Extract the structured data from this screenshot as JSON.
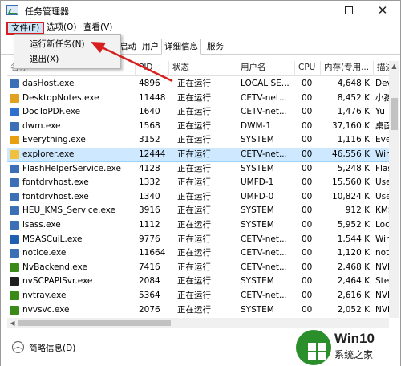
{
  "window": {
    "title": "任务管理器",
    "minimize_glyph": "—",
    "close_glyph": "✕"
  },
  "menu": {
    "file": "文件(F)",
    "options": "选项(O)",
    "view": "查看(V)"
  },
  "file_menu": {
    "run_new_task": "运行新任务(N)",
    "exit": "退出(X)"
  },
  "tabs": {
    "startup": "启动",
    "users": "用户",
    "details": "详细信息",
    "services": "服务"
  },
  "table": {
    "headers": {
      "name": "名称",
      "pid": "PID",
      "status": "状态",
      "user": "用户名",
      "cpu": "CPU",
      "memory": "内存(专用...",
      "description": "描述"
    },
    "rows": [
      {
        "name": "dasHost.exe",
        "pid": "4896",
        "status": "正在运行",
        "user": "LOCAL SE...",
        "cpu": "00",
        "memory": "4,648 K",
        "desc": "Dev",
        "icon": "window-icon",
        "icon_color": "#3b6fb6"
      },
      {
        "name": "DesktopNotes.exe",
        "pid": "11448",
        "status": "正在运行",
        "user": "CETV-net...",
        "cpu": "00",
        "memory": "8,452 K",
        "desc": "小孩",
        "icon": "notes-icon",
        "icon_color": "#e0a020"
      },
      {
        "name": "DocToPDF.exe",
        "pid": "1640",
        "status": "正在运行",
        "user": "CETV-net...",
        "cpu": "00",
        "memory": "1,476 K",
        "desc": "Yu",
        "icon": "doc-icon",
        "icon_color": "#2e6fd0"
      },
      {
        "name": "dwm.exe",
        "pid": "1568",
        "status": "正在运行",
        "user": "DWM-1",
        "cpu": "00",
        "memory": "37,160 K",
        "desc": "桌面",
        "icon": "window-icon",
        "icon_color": "#3b6fb6"
      },
      {
        "name": "Everything.exe",
        "pid": "3152",
        "status": "正在运行",
        "user": "SYSTEM",
        "cpu": "00",
        "memory": "1,116 K",
        "desc": "Ever",
        "icon": "search-icon",
        "icon_color": "#e8a010"
      },
      {
        "name": "explorer.exe",
        "pid": "12444",
        "status": "正在运行",
        "user": "CETV-net...",
        "cpu": "00",
        "memory": "46,556 K",
        "desc": "Win",
        "icon": "folder-icon",
        "icon_color": "#f0c040",
        "selected": true
      },
      {
        "name": "FlashHelperService.exe",
        "pid": "4128",
        "status": "正在运行",
        "user": "SYSTEM",
        "cpu": "00",
        "memory": "5,248 K",
        "desc": "Flas",
        "icon": "window-icon",
        "icon_color": "#3b6fb6"
      },
      {
        "name": "fontdrvhost.exe",
        "pid": "1332",
        "status": "正在运行",
        "user": "UMFD-1",
        "cpu": "00",
        "memory": "15,560 K",
        "desc": "Use",
        "icon": "window-icon",
        "icon_color": "#3b6fb6"
      },
      {
        "name": "fontdrvhost.exe",
        "pid": "1340",
        "status": "正在运行",
        "user": "UMFD-0",
        "cpu": "00",
        "memory": "10,824 K",
        "desc": "Use",
        "icon": "window-icon",
        "icon_color": "#3b6fb6"
      },
      {
        "name": "HEU_KMS_Service.exe",
        "pid": "3916",
        "status": "正在运行",
        "user": "SYSTEM",
        "cpu": "00",
        "memory": "912 K",
        "desc": "KMS",
        "icon": "window-icon",
        "icon_color": "#3b6fb6"
      },
      {
        "name": "lsass.exe",
        "pid": "1112",
        "status": "正在运行",
        "user": "SYSTEM",
        "cpu": "00",
        "memory": "5,952 K",
        "desc": "Loc",
        "icon": "window-icon",
        "icon_color": "#3b6fb6"
      },
      {
        "name": "MSASCuiL.exe",
        "pid": "9776",
        "status": "正在运行",
        "user": "CETV-net...",
        "cpu": "00",
        "memory": "1,544 K",
        "desc": "Win",
        "icon": "shield-icon",
        "icon_color": "#1e5fb0"
      },
      {
        "name": "notice.exe",
        "pid": "11664",
        "status": "正在运行",
        "user": "CETV-net...",
        "cpu": "00",
        "memory": "1,120 K",
        "desc": "notic",
        "icon": "window-icon",
        "icon_color": "#3b6fb6"
      },
      {
        "name": "NvBackend.exe",
        "pid": "7416",
        "status": "正在运行",
        "user": "CETV-net...",
        "cpu": "00",
        "memory": "2,468 K",
        "desc": "NVI",
        "icon": "nvidia-icon",
        "icon_color": "#3a8a1a"
      },
      {
        "name": "nvSCPAPISvr.exe",
        "pid": "2084",
        "status": "正在运行",
        "user": "SYSTEM",
        "cpu": "00",
        "memory": "2,464 K",
        "desc": "Ster",
        "icon": "nvidia-icon",
        "icon_color": "#1f1f1f"
      },
      {
        "name": "nvtray.exe",
        "pid": "5364",
        "status": "正在运行",
        "user": "CETV-net...",
        "cpu": "00",
        "memory": "2,616 K",
        "desc": "NVI",
        "icon": "nvidia-icon",
        "icon_color": "#3a8a1a"
      },
      {
        "name": "nvvsvc.exe",
        "pid": "2076",
        "status": "正在运行",
        "user": "SYSTEM",
        "cpu": "00",
        "memory": "2,052 K",
        "desc": "NVI",
        "icon": "nvidia-icon",
        "icon_color": "#3a8a1a"
      }
    ]
  },
  "statusbar": {
    "fewer_details_prefix": "简略信息(",
    "fewer_details_key": "D",
    "fewer_details_suffix": ")"
  },
  "watermark": {
    "line1": "Win10",
    "line2": "系统之家"
  },
  "colors": {
    "highlight_border": "#d62020",
    "selection_bg": "#cde8ff",
    "arrow": "#d62020"
  }
}
